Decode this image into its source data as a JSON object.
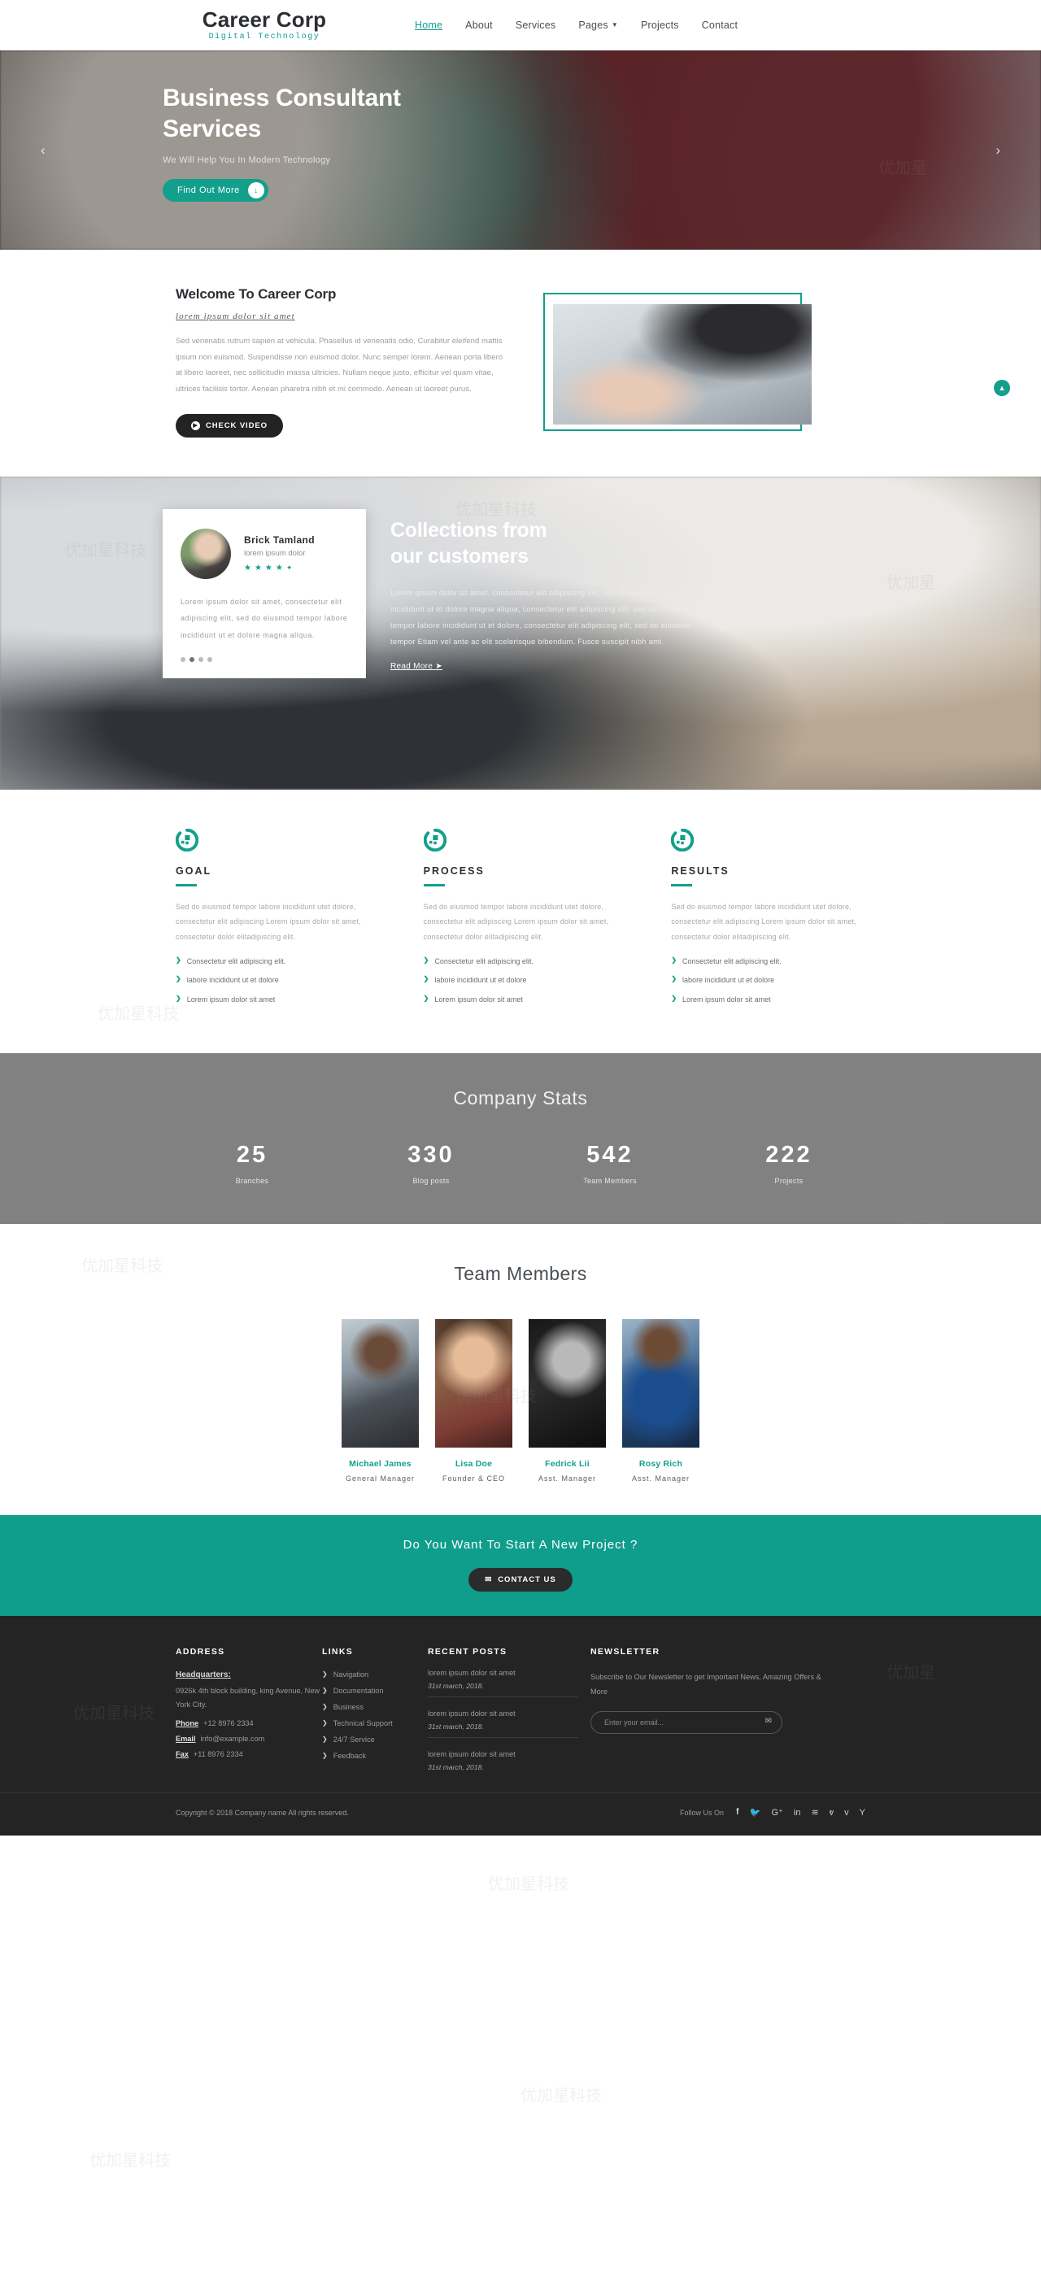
{
  "nav": {
    "brand_name": "Career Corp",
    "brand_sub": "Digital Technology",
    "items": [
      {
        "label": "Home",
        "active": true
      },
      {
        "label": "About",
        "active": false
      },
      {
        "label": "Services",
        "active": false
      },
      {
        "label": "Pages",
        "active": false,
        "caret": true
      },
      {
        "label": "Projects",
        "active": false
      },
      {
        "label": "Contact",
        "active": false
      }
    ]
  },
  "hero": {
    "title_line1": "Business Consultant",
    "title_line2": "Services",
    "subtitle": "We Will Help You In Modern Technology",
    "button_label": "Find Out More",
    "button_icon": "arrow-down-icon",
    "prev_icon": "chevron-left-icon",
    "next_icon": "chevron-right-icon",
    "slide_count": 4,
    "active_slide": 2
  },
  "welcome": {
    "heading": "Welcome To Career Corp",
    "subheading": "lorem ipsum dolor sit amet",
    "paragraph": "Sed venenatis rutrum sapien at vehicula. Phasellus id venenatis odio. Curabitur eleifend mattis ipsum non euismod. Suspendisse non euismod dolor. Nunc semper lorem. Aenean porta libero at libero laoreet, nec sollicitudin massa ultricies. Nullam neque justo, efficitur vel quam vitae, ultrices facilisis tortor. Aenean pharetra nibh et mi commodo. Aenean ut laoreet purus.",
    "button_label": "CHECK VIDEO",
    "button_icon": "play-circle-icon",
    "scroll_top_icon": "chevron-up-icon",
    "accent_color": "#12a08c"
  },
  "testimonial": {
    "name": "Brick Tamland",
    "role": "lorem ipsum dolor",
    "rating": 4.5,
    "quote": "Lorem ipsum dolor sit amet, consectetur elit adipiscing elit, sed do eiusmod tempor labore incididunt ut et dolore magna aliqua.",
    "dot_count": 4,
    "active_dot": 2,
    "heading_line1": "Collections from",
    "heading_line2": "our customers",
    "paragraph": "Lorem ipsum dolor sit amet, consectetur elit adipiscing elit, sed do eiusmod tempor labore incididunt ut et dolore magna aliqua, consectetur elit adipiscing elit, sed do eiusmod tempor labore incididunt ut et dolore, consectetur elit adipiscing elit, sed do eiusmod tempor Etiam vel ante ac elit scelerisque bibendum. Fusce suscipit nibh ami.",
    "read_more": "Read More"
  },
  "features": [
    {
      "title": "GOAL",
      "icon": "target-badge-icon",
      "paragraph": "Sed do eiusmod tempor labore incididunt utet dolore, consectetur elit adipiscing Lorem ipsum dolor sit amet, consectetur dolor elitadipiscing elit.",
      "bullets": [
        "Consectetur elit adipiscing elit.",
        "labore incididunt ut et dolore",
        "Lorem ipsum dolor sit amet"
      ]
    },
    {
      "title": "PROCESS",
      "icon": "target-badge-icon",
      "paragraph": "Sed do eiusmod tempor labore incididunt utet dolore, consectetur elit adipiscing Lorem ipsum dolor sit amet, consectetur dolor elitadipiscing elit.",
      "bullets": [
        "Consectetur elit adipiscing elit.",
        "labore incididunt ut et dolore",
        "Lorem ipsum dolor sit amet"
      ]
    },
    {
      "title": "RESULTS",
      "icon": "target-badge-icon",
      "paragraph": "Sed do eiusmod tempor labore incididunt utet dolore, consectetur elit adipiscing Lorem ipsum dolor sit amet, consectetur dolor elitadipiscing elit.",
      "bullets": [
        "Consectetur elit adipiscing elit.",
        "labore incididunt ut et dolore",
        "Lorem ipsum dolor sit amet"
      ]
    }
  ],
  "stats": {
    "heading": "Company Stats",
    "background_color": "#818181",
    "items": [
      {
        "number": "25",
        "label": "Branches"
      },
      {
        "number": "330",
        "label": "Blog posts"
      },
      {
        "number": "542",
        "label": "Team Members"
      },
      {
        "number": "222",
        "label": "Projects"
      }
    ]
  },
  "team": {
    "heading": "Team Members",
    "members": [
      {
        "name": "Michael James",
        "role": "General Manager"
      },
      {
        "name": "Lisa Doe",
        "role": "Founder & CEO"
      },
      {
        "name": "Fedrick Lii",
        "role": "Asst. Manager"
      },
      {
        "name": "Rosy Rich",
        "role": "Asst. Manager"
      }
    ]
  },
  "cta": {
    "heading": "Do You Want To Start A New Project ?",
    "button_label": "CONTACT US",
    "button_icon": "envelope-icon",
    "background_color": "#0f9d8c"
  },
  "footer": {
    "address": {
      "heading": "ADDRESS",
      "hq_label": "Headquarters:",
      "street": "0926k 4th block building, king Avenue, New York City.",
      "phone_label": "Phone",
      "phone_value": "+12 8976 2334",
      "email_label": "Email",
      "email_value": "info@example.com",
      "fax_label": "Fax",
      "fax_value": "+11 8976 2334"
    },
    "links": {
      "heading": "LINKS",
      "items": [
        "Navigation",
        "Documentation",
        "Business",
        "Technical Support",
        "24/7 Service",
        "Feedback"
      ]
    },
    "recent_posts": {
      "heading": "RECENT POSTS",
      "items": [
        {
          "title": "lorem ipsum dolor sit amet",
          "date": "31st march, 2018."
        },
        {
          "title": "lorem ipsum dolor sit amet",
          "date": "31st march, 2018."
        },
        {
          "title": "lorem ipsum dolor sit amet",
          "date": "31st march, 2018."
        }
      ]
    },
    "newsletter": {
      "heading": "NEWSLETTER",
      "description": "Subscribe to Our Newsletter to get Important News, Amazing Offers & More",
      "placeholder": "Enter your email...",
      "submit_icon": "envelope-icon"
    },
    "copyright": "Copyright © 2018 Company name All rights reserved.",
    "follow_label": "Follow Us On",
    "social": [
      "facebook-icon",
      "twitter-icon",
      "google-plus-icon",
      "linkedin-icon",
      "rss-icon",
      "vk-icon",
      "vimeo-icon",
      "yahoo-icon"
    ]
  }
}
